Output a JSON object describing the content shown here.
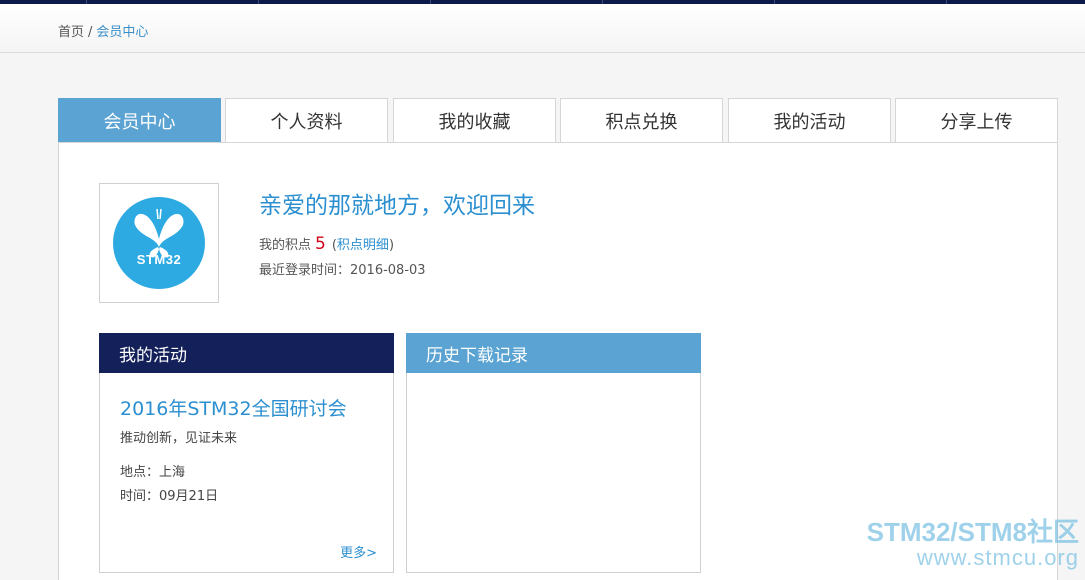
{
  "breadcrumb": {
    "home": "首页",
    "separator": "/",
    "current": "会员中心"
  },
  "tabs": [
    {
      "label": "会员中心",
      "active": true
    },
    {
      "label": "个人资料",
      "active": false
    },
    {
      "label": "我的收藏",
      "active": false
    },
    {
      "label": "积点兑换",
      "active": false
    },
    {
      "label": "我的活动",
      "active": false
    },
    {
      "label": "分享上传",
      "active": false
    }
  ],
  "profile": {
    "avatar_text": "STM32",
    "welcome": "亲爱的那就地方，欢迎回来",
    "points_label": "我的积点",
    "points_value": "5",
    "points_detail_open": "(",
    "points_detail_link": "积点明细",
    "points_detail_close": ")",
    "last_login": "最近登录时间：2016-08-03"
  },
  "activity_card": {
    "title": "我的活动",
    "event_title": "2016年STM32全国研讨会",
    "event_subtitle": "推动创新，见证未来",
    "event_location": "地点：上海",
    "event_time": "时间：09月21日",
    "more": "更多>"
  },
  "history_card": {
    "title": "历史下载记录"
  },
  "watermark": {
    "line1": "STM32/STM8社区",
    "line2": "www.stmcu.org"
  },
  "colors": {
    "accent": "#5aa3d2",
    "navy": "#13205a",
    "link": "#2b8fd0",
    "points": "#d0021b"
  }
}
